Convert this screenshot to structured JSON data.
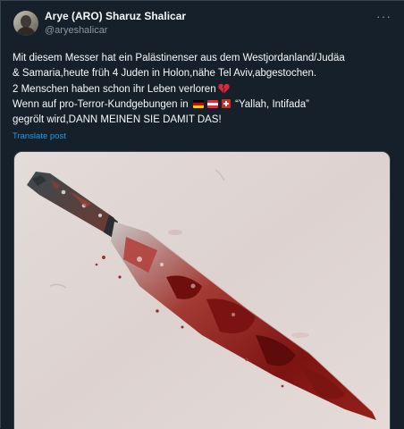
{
  "author": {
    "name": "Arye (ARO) Sharuz Shalicar",
    "handle": "@aryeshalicar"
  },
  "more_label": "···",
  "tweet_text": {
    "line1": "Mit diesem Messer hat ein Palästinenser aus dem Westjordanland/Judäa",
    "line2": "& Samaria,heute früh 4 Juden in Holon,nähe Tel Aviv,abgestochen.",
    "line3": "2 Menschen haben schon ihr Leben verloren",
    "line4_pre": "Wenn auf pro-Terror-Kundgebungen in",
    "line4_post": "“Yallah, Intifada”",
    "line5": "gegrölt wird,DANN MEINEN SIE DAMIT DAS!"
  },
  "translate_label": "Translate post",
  "icons": {
    "heart": "broken-heart-icon",
    "flags": [
      "germany-flag-icon",
      "austria-flag-icon",
      "switzerland-flag-icon"
    ]
  },
  "colors": {
    "background": "#15202b",
    "text": "#f7f9f9",
    "secondary": "#8b98a5",
    "link": "#1d9bf0",
    "border": "#38444d"
  }
}
